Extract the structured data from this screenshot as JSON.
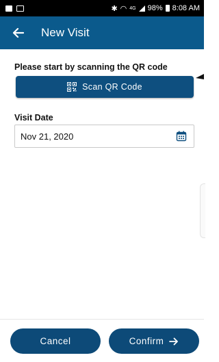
{
  "status_bar": {
    "battery_text": "98%",
    "time": "8:08 AM",
    "network_label": "4G"
  },
  "app_bar": {
    "title": "New Visit",
    "back_icon": "arrow-left-icon",
    "color": "#0b5a8c"
  },
  "scan": {
    "prompt": "Please start by scanning the QR code",
    "button_label": "Scan QR Code",
    "icon": "qr-code-icon"
  },
  "visit_date": {
    "label": "Visit Date",
    "value": "Nov 21, 2020",
    "icon": "calendar-icon"
  },
  "footer": {
    "cancel_label": "Cancel",
    "confirm_label": "Confirm",
    "confirm_icon": "arrow-right-icon",
    "button_color": "#0d4a78"
  }
}
